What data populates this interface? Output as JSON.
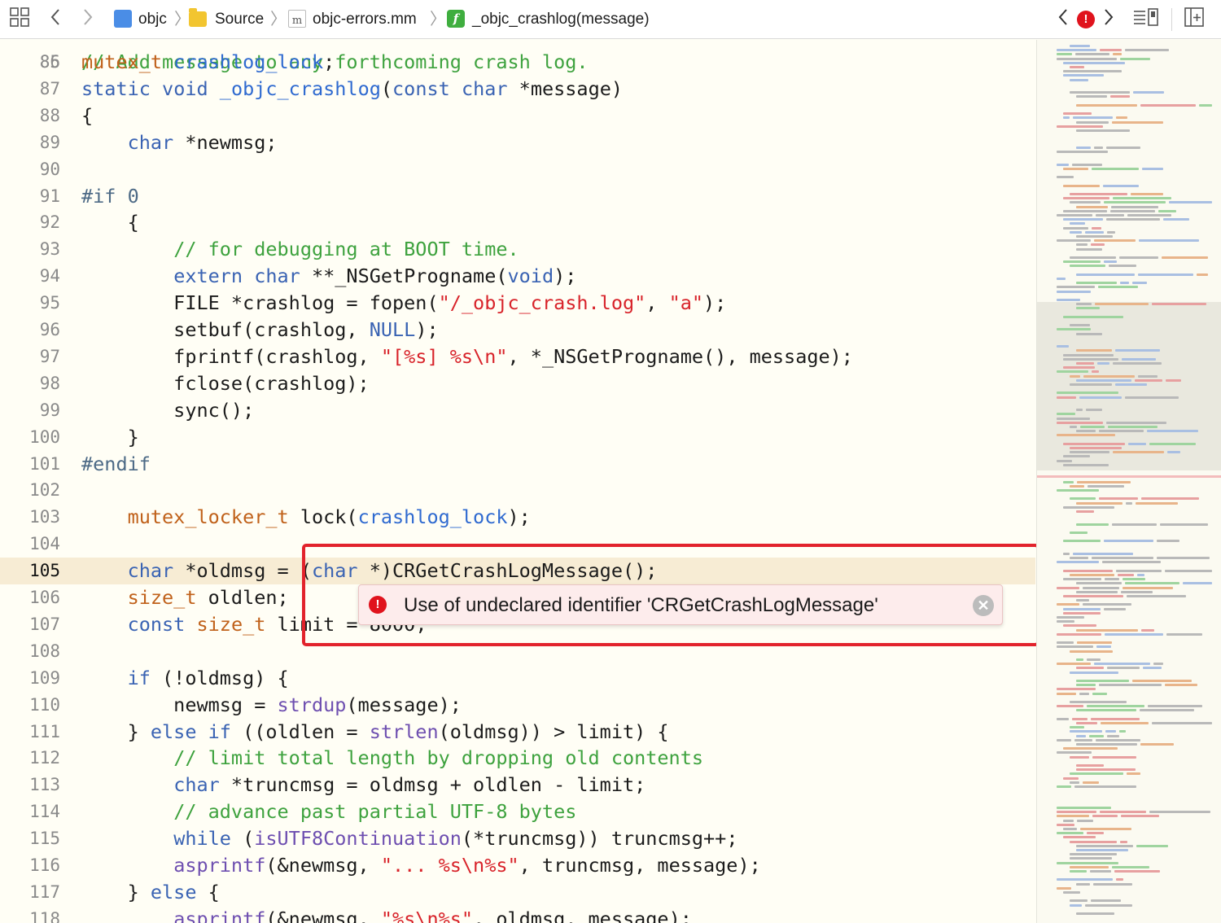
{
  "breadcrumbs": [
    "objc",
    "Source",
    "objc-errors.mm",
    "_objc_crashlog(message)"
  ],
  "icons": {
    "grid": "grid-icon",
    "back": "chevron-left-icon",
    "forward": "chevron-right-icon",
    "project": "project-icon",
    "folder": "folder-icon",
    "file": "objc-file-icon",
    "function": "function-icon",
    "issue": "error-icon",
    "minimap": "minimap-toggle-icon",
    "add_editor": "add-editor-icon"
  },
  "file_icon_glyph": "m",
  "function_icon_glyph": "f",
  "error_glyph": "!",
  "close_glyph": "✕",
  "current_line": 105,
  "error": {
    "message": "Use of undeclared identifier 'CRGetCrashLogMessage'"
  },
  "colors": {
    "keyword": "#3a63b3",
    "type": "#c0611a",
    "comment": "#3ea23e",
    "string": "#d8232a",
    "error": "#e0131d",
    "current_line_bg": "#f7ecd4"
  },
  "lines": [
    {
      "n": "86",
      "segs": [
        [
          "mutex_t",
          "ty"
        ],
        [
          " "
        ],
        [
          "crashlog_lock",
          "fn"
        ],
        [
          ";"
        ]
      ]
    },
    {
      "n": "87",
      "segs": [
        [
          "static",
          "kw"
        ],
        [
          " "
        ],
        [
          "void",
          "kw"
        ],
        [
          " "
        ],
        [
          "_objc_crashlog",
          "fn"
        ],
        [
          "("
        ],
        [
          "const",
          "kw"
        ],
        [
          " "
        ],
        [
          "char",
          "kw"
        ],
        [
          " *message)"
        ]
      ]
    },
    {
      "n": "88",
      "segs": [
        [
          "{"
        ]
      ]
    },
    {
      "n": "89",
      "segs": [
        [
          "    "
        ],
        [
          "char",
          "kw"
        ],
        [
          " *newmsg;"
        ]
      ]
    },
    {
      "n": "90",
      "segs": []
    },
    {
      "n": "91",
      "segs": [
        [
          "#if 0",
          "pp"
        ]
      ]
    },
    {
      "n": "92",
      "segs": [
        [
          "    {"
        ]
      ]
    },
    {
      "n": "93",
      "segs": [
        [
          "        "
        ],
        [
          "// for debugging at BOOT time.",
          "cm"
        ]
      ]
    },
    {
      "n": "94",
      "segs": [
        [
          "        "
        ],
        [
          "extern",
          "kw"
        ],
        [
          " "
        ],
        [
          "char",
          "kw"
        ],
        [
          " **_NSGetProgname("
        ],
        [
          "void",
          "kw"
        ],
        [
          ");"
        ]
      ]
    },
    {
      "n": "95",
      "segs": [
        [
          "        FILE *crashlog = fopen("
        ],
        [
          "\"/_objc_crash.log\"",
          "st"
        ],
        [
          ", "
        ],
        [
          "\"a\"",
          "st"
        ],
        [
          ");"
        ]
      ]
    },
    {
      "n": "96",
      "segs": [
        [
          "        setbuf(crashlog, "
        ],
        [
          "NULL",
          "kw"
        ],
        [
          ");"
        ]
      ]
    },
    {
      "n": "97",
      "segs": [
        [
          "        fprintf(crashlog, "
        ],
        [
          "\"[%s] %s\\n\"",
          "st"
        ],
        [
          ", *_NSGetProgname(), message);"
        ]
      ]
    },
    {
      "n": "98",
      "segs": [
        [
          "        fclose(crashlog);"
        ]
      ]
    },
    {
      "n": "99",
      "segs": [
        [
          "        sync();"
        ]
      ]
    },
    {
      "n": "100",
      "segs": [
        [
          "    }"
        ]
      ]
    },
    {
      "n": "101",
      "segs": [
        [
          "#endif",
          "pp"
        ]
      ]
    },
    {
      "n": "102",
      "segs": []
    },
    {
      "n": "103",
      "segs": [
        [
          "    "
        ],
        [
          "mutex_locker_t",
          "ty"
        ],
        [
          " lock("
        ],
        [
          "crashlog_lock",
          "fn"
        ],
        [
          ");"
        ]
      ]
    },
    {
      "n": "104",
      "segs": []
    },
    {
      "n": "105",
      "segs": [
        [
          "    "
        ],
        [
          "char",
          "kw"
        ],
        [
          " *oldmsg = ("
        ],
        [
          "char",
          "kw"
        ],
        [
          " *)CRGetCrashLogMessage();"
        ]
      ]
    },
    {
      "n": "106",
      "segs": [
        [
          "    "
        ],
        [
          "size_t",
          "ty"
        ],
        [
          " oldlen;"
        ]
      ]
    },
    {
      "n": "107",
      "segs": [
        [
          "    "
        ],
        [
          "const",
          "kw"
        ],
        [
          " "
        ],
        [
          "size_t",
          "ty"
        ],
        [
          " limit = 8000;"
        ]
      ]
    },
    {
      "n": "108",
      "segs": []
    },
    {
      "n": "109",
      "segs": [
        [
          "    "
        ],
        [
          "if",
          "kw"
        ],
        [
          " (!oldmsg) {"
        ]
      ]
    },
    {
      "n": "110",
      "segs": [
        [
          "        newmsg = "
        ],
        [
          "strdup",
          "mac"
        ],
        [
          "(message);"
        ]
      ]
    },
    {
      "n": "111",
      "segs": [
        [
          "    } "
        ],
        [
          "else",
          "kw"
        ],
        [
          " "
        ],
        [
          "if",
          "kw"
        ],
        [
          " ((oldlen = "
        ],
        [
          "strlen",
          "mac"
        ],
        [
          "(oldmsg)) > limit) {"
        ]
      ]
    },
    {
      "n": "112",
      "segs": [
        [
          "        "
        ],
        [
          "// limit total length by dropping old contents",
          "cm"
        ]
      ]
    },
    {
      "n": "113",
      "segs": [
        [
          "        "
        ],
        [
          "char",
          "kw"
        ],
        [
          " *truncmsg = oldmsg + oldlen - limit;"
        ]
      ]
    },
    {
      "n": "114",
      "segs": [
        [
          "        "
        ],
        [
          "// advance past partial UTF-8 bytes",
          "cm"
        ]
      ]
    },
    {
      "n": "115",
      "segs": [
        [
          "        "
        ],
        [
          "while",
          "kw"
        ],
        [
          " ("
        ],
        [
          "isUTF8Continuation",
          "mac"
        ],
        [
          "(*truncmsg)) truncmsg++;"
        ]
      ]
    },
    {
      "n": "116",
      "segs": [
        [
          "        "
        ],
        [
          "asprintf",
          "mac"
        ],
        [
          "(&newmsg, "
        ],
        [
          "\"... %s\\n%s\"",
          "st"
        ],
        [
          ", truncmsg, message);"
        ]
      ]
    },
    {
      "n": "117",
      "segs": [
        [
          "    } "
        ],
        [
          "else",
          "kw"
        ],
        [
          " {"
        ]
      ]
    },
    {
      "n": "118",
      "segs": [
        [
          "        "
        ],
        [
          "asprintf",
          "mac"
        ],
        [
          "(&newmsg, "
        ],
        [
          "\"%s\\n%s\"",
          "st"
        ],
        [
          ", oldmsg, message);"
        ]
      ]
    }
  ]
}
